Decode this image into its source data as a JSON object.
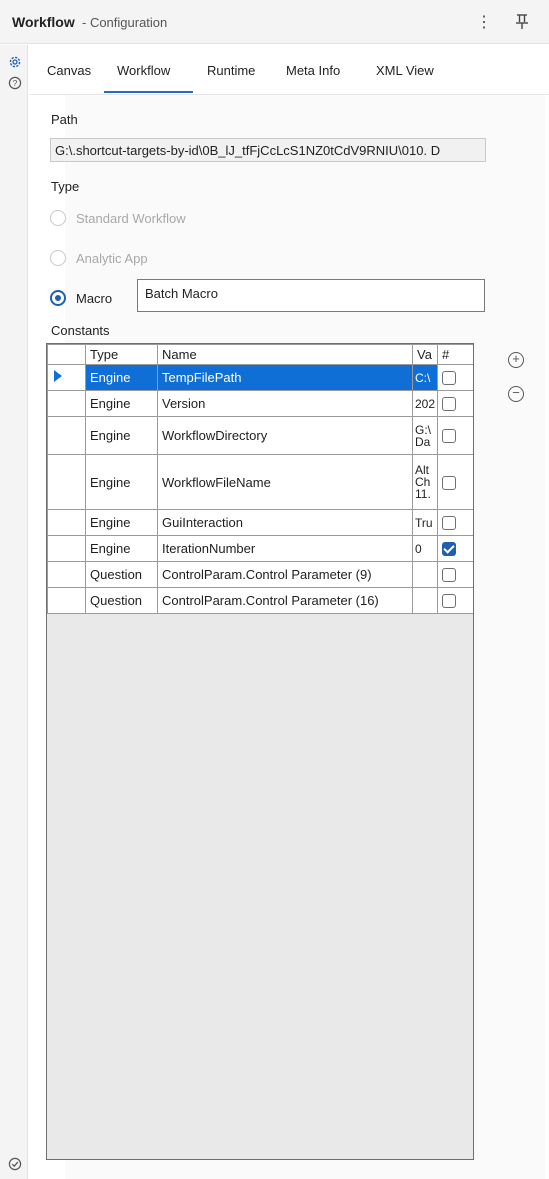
{
  "window": {
    "title": "Workflow",
    "subtitle": "- Configuration"
  },
  "tabs": [
    {
      "label": "Canvas"
    },
    {
      "label": "Workflow"
    },
    {
      "label": "Runtime"
    },
    {
      "label": "Meta Info"
    },
    {
      "label": "XML View"
    }
  ],
  "active_tab": "Workflow",
  "path": {
    "label": "Path",
    "value": "G:\\.shortcut-targets-by-id\\0B_lJ_tfFjCcLcS1NZ0tCdV9RNIU\\010. D"
  },
  "type": {
    "label": "Type",
    "options": [
      {
        "label": "Standard Workflow",
        "selected": false,
        "disabled": true
      },
      {
        "label": "Analytic App",
        "selected": false,
        "disabled": true
      },
      {
        "label": "Macro",
        "selected": true,
        "disabled": false
      }
    ],
    "macro_type": "Batch Macro"
  },
  "constants": {
    "label": "Constants",
    "columns": [
      "Type",
      "Name",
      "Va",
      "#"
    ],
    "rows": [
      {
        "type": "Engine",
        "name": "TempFilePath",
        "value": "C:\\",
        "checked": false,
        "selected": true
      },
      {
        "type": "Engine",
        "name": "Version",
        "value": "202",
        "checked": false,
        "selected": false
      },
      {
        "type": "Engine",
        "name": "WorkflowDirectory",
        "value": "G:\\ Da",
        "checked": false,
        "selected": false
      },
      {
        "type": "Engine",
        "name": "WorkflowFileName",
        "value": "Alt Ch 11.",
        "checked": false,
        "selected": false
      },
      {
        "type": "Engine",
        "name": "GuiInteraction",
        "value": "Tru",
        "checked": false,
        "selected": false
      },
      {
        "type": "Engine",
        "name": "IterationNumber",
        "value": "0",
        "checked": true,
        "selected": false
      },
      {
        "type": "Question",
        "name": "ControlParam.Control Parameter (9)",
        "value": "",
        "checked": false,
        "selected": false
      },
      {
        "type": "Question",
        "name": "ControlParam.Control Parameter (16)",
        "value": "",
        "checked": false,
        "selected": false
      }
    ]
  },
  "icons": {
    "more": "more-vertical-icon",
    "pin": "pin-icon",
    "settings": "gear-icon",
    "help": "help-icon",
    "status": "check-circle-icon",
    "add": "plus-circle-icon",
    "remove": "minus-circle-icon"
  },
  "colors": {
    "accent": "#1e5fb3",
    "selection": "#0f6fd6"
  }
}
